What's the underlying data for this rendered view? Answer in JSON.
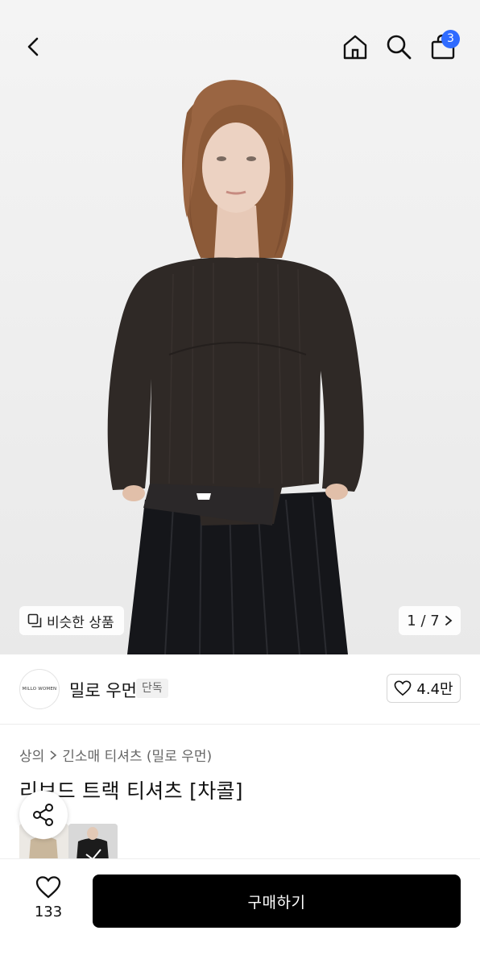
{
  "header": {
    "back_icon": "chevron-left-icon",
    "home_icon": "home-icon",
    "search_icon": "search-icon",
    "bag_icon": "shopping-bag-icon",
    "cart_count": "3",
    "badge_color": "#2f6bff"
  },
  "gallery": {
    "similar_label": "비슷한 상품",
    "similar_icon": "copy-icon",
    "pager": "1 / 7",
    "pager_icon": "chevron-right-icon"
  },
  "brand": {
    "logo_text": "MILLO WOMEN",
    "name": "밀로 우먼",
    "tag": "단독",
    "likes": "4.4만",
    "like_icon": "heart-icon"
  },
  "product": {
    "category": "상의",
    "subcategory": "긴소매 티셔츠 (밀로 우먼)",
    "title": "리브드 트랙 티셔츠 [차콜]"
  },
  "share": {
    "icon": "share-icon"
  },
  "bottom": {
    "wish_icon": "heart-icon",
    "wish_count": "133",
    "buy_label": "구매하기",
    "buy_color": "#000000"
  }
}
